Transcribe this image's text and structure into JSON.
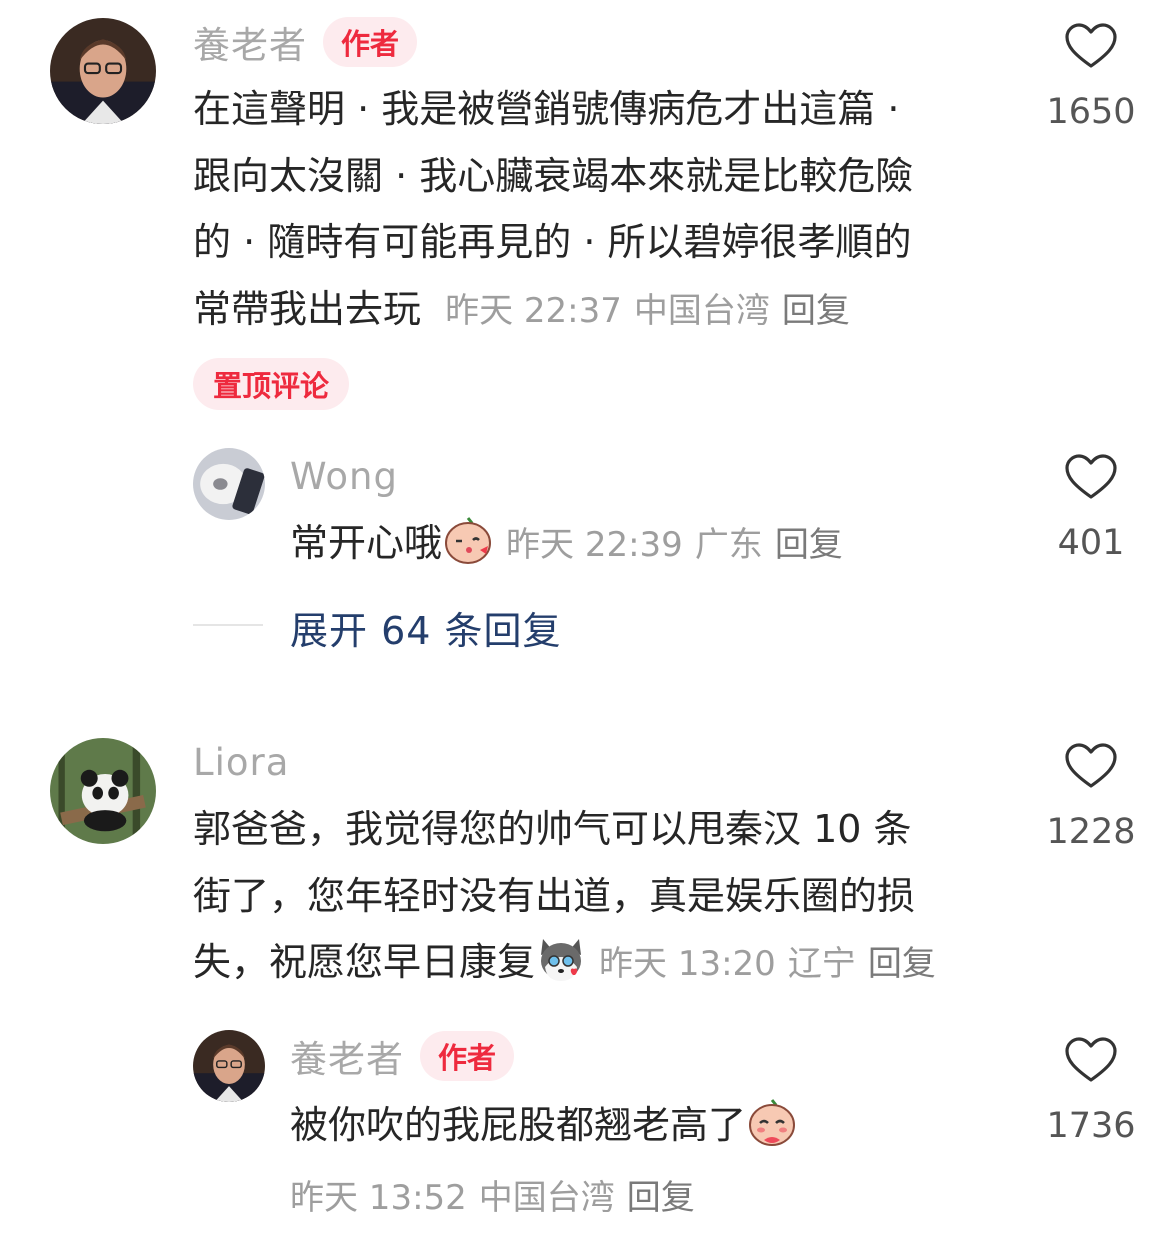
{
  "comments": [
    {
      "user": "養老者",
      "badge": "作者",
      "text_lines": [
        "在這聲明 · 我是被營銷號傳病危才出這篇 ·",
        "跟向太沒關 · 我心臟衰竭本來就是比較危險",
        "的 · 隨時有可能再見的 · 所以碧婷很孝順的",
        "常帶我出去玩"
      ],
      "time": "昨天 22:37",
      "location": "中国台湾",
      "reply": "回复",
      "likes": "1650",
      "pinned_label": "置顶评论",
      "sub": {
        "user": "Wong",
        "text": "常开心哦",
        "emoji": "kiss-face-emoji",
        "time": "昨天 22:39",
        "location": "广东",
        "reply": "回复",
        "likes": "401"
      },
      "expand_label": "展开 64 条回复"
    },
    {
      "user": "Liora",
      "text_lines": [
        "郭爸爸，我觉得您的帅气可以甩秦汉 10 条",
        "街了，您年轻时没有出道，真是娱乐圈的损",
        "失，祝愿您早日康复"
      ],
      "emoji": "husky-heart-emoji",
      "time": "昨天 13:20",
      "location": "辽宁",
      "reply": "回复",
      "likes": "1228",
      "sub": {
        "user": "養老者",
        "badge": "作者",
        "text": "被你吹的我屁股都翘老高了",
        "emoji": "shy-face-emoji",
        "time": "昨天 13:52",
        "location": "中国台湾",
        "reply": "回复",
        "likes": "1736"
      }
    }
  ],
  "colors": {
    "badge_bg": "#fdebee",
    "badge_text": "#ee2a3e",
    "link": "#243e6c",
    "meta": "#9e9e9e"
  }
}
